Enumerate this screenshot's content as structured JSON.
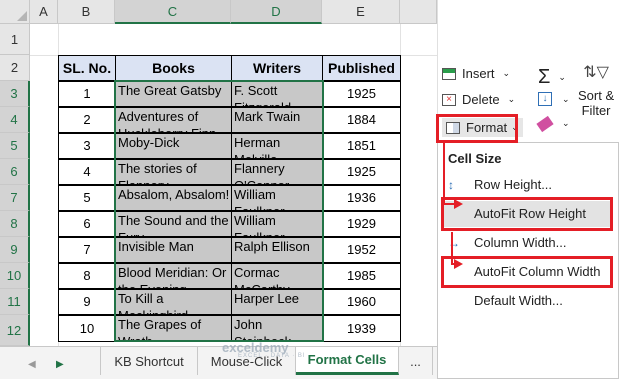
{
  "columns": [
    "A",
    "B",
    "C",
    "D",
    "E"
  ],
  "rows": [
    "1",
    "2",
    "3",
    "4",
    "5",
    "6",
    "7",
    "8",
    "9",
    "10",
    "11",
    "12"
  ],
  "table": {
    "headers": [
      "SL. No.",
      "Books",
      "Writers",
      "Published"
    ],
    "rows": [
      {
        "sl": "1",
        "book": "The Great Gatsby",
        "writer": "F. Scott Fitzgerald",
        "year": "1925"
      },
      {
        "sl": "2",
        "book": "Adventures of Huckleberry Finn",
        "writer": "Mark Twain",
        "year": "1884"
      },
      {
        "sl": "3",
        "book": "Moby-Dick",
        "writer": "Herman Melville",
        "year": "1851"
      },
      {
        "sl": "4",
        "book": "The stories of Flannery",
        "writer": "Flannery O'Connor",
        "year": "1925"
      },
      {
        "sl": "5",
        "book": "Absalom, Absalom!",
        "writer": "William Faulkner",
        "year": "1936"
      },
      {
        "sl": "6",
        "book": "The Sound and the Fury",
        "writer": "William Faulkner",
        "year": "1929"
      },
      {
        "sl": "7",
        "book": "Invisible Man",
        "writer": "Ralph Ellison",
        "year": "1952"
      },
      {
        "sl": "8",
        "book": "Blood Meridian: Or the Evening",
        "writer": "Cormac McCarthy",
        "year": "1985"
      },
      {
        "sl": "9",
        "book": "To Kill a Mockingbird",
        "writer": "Harper Lee",
        "year": "1960"
      },
      {
        "sl": "10",
        "book": "The Grapes of Wrath",
        "writer": "John Steinbeck",
        "year": "1939"
      }
    ]
  },
  "tabs": {
    "items": [
      "KB Shortcut",
      "Mouse-Click",
      "Format Cells"
    ],
    "active": "Format Cells",
    "more": "..."
  },
  "watermark": {
    "name": "exceldemy",
    "tagline": "EXCEL · DATA · BI"
  },
  "ribbon": {
    "insert": "Insert",
    "delete": "Delete",
    "format": "Format",
    "sort_filter_line1": "Sort &",
    "sort_filter_line2": "Filter"
  },
  "menu": {
    "heading": "Cell Size",
    "row_height": "Row Height...",
    "autofit_row_height": "AutoFit Row Height",
    "column_width": "Column Width...",
    "autofit_column_width": "AutoFit Column Width",
    "default_width": "Default Width..."
  },
  "colors": {
    "accent": "#217346",
    "highlight_red": "#e41e26",
    "header_fill": "#dbe3f3"
  }
}
